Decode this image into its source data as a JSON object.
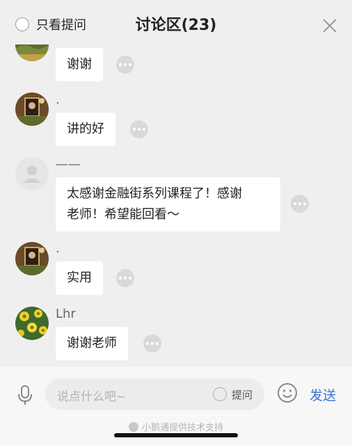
{
  "header": {
    "filter_label": "只看提问",
    "title": "讨论区(23)",
    "close_icon": "close-icon"
  },
  "messages": [
    {
      "name": "",
      "text": "谢谢",
      "avatar": "landscape-photo"
    },
    {
      "name": ".",
      "text": "讲的好",
      "avatar": "portrait-painting"
    },
    {
      "name": "——",
      "text_lines": [
        "太感谢金融街系列课程了！感谢",
        "老师！希望能回看～"
      ],
      "avatar": "default-avatar"
    },
    {
      "name": ".",
      "text": "实用",
      "avatar": "portrait-painting"
    },
    {
      "name": "Lhr",
      "text": "谢谢老师",
      "avatar": "yellow-flowers"
    }
  ],
  "footer": {
    "input_placeholder": "说点什么吧~",
    "ask_label": "提问",
    "send_label": "发送",
    "powered_by": "小鹅通提供技术支持"
  },
  "colors": {
    "background": "#efefef",
    "bubble": "#ffffff",
    "send": "#3a6fd8"
  }
}
